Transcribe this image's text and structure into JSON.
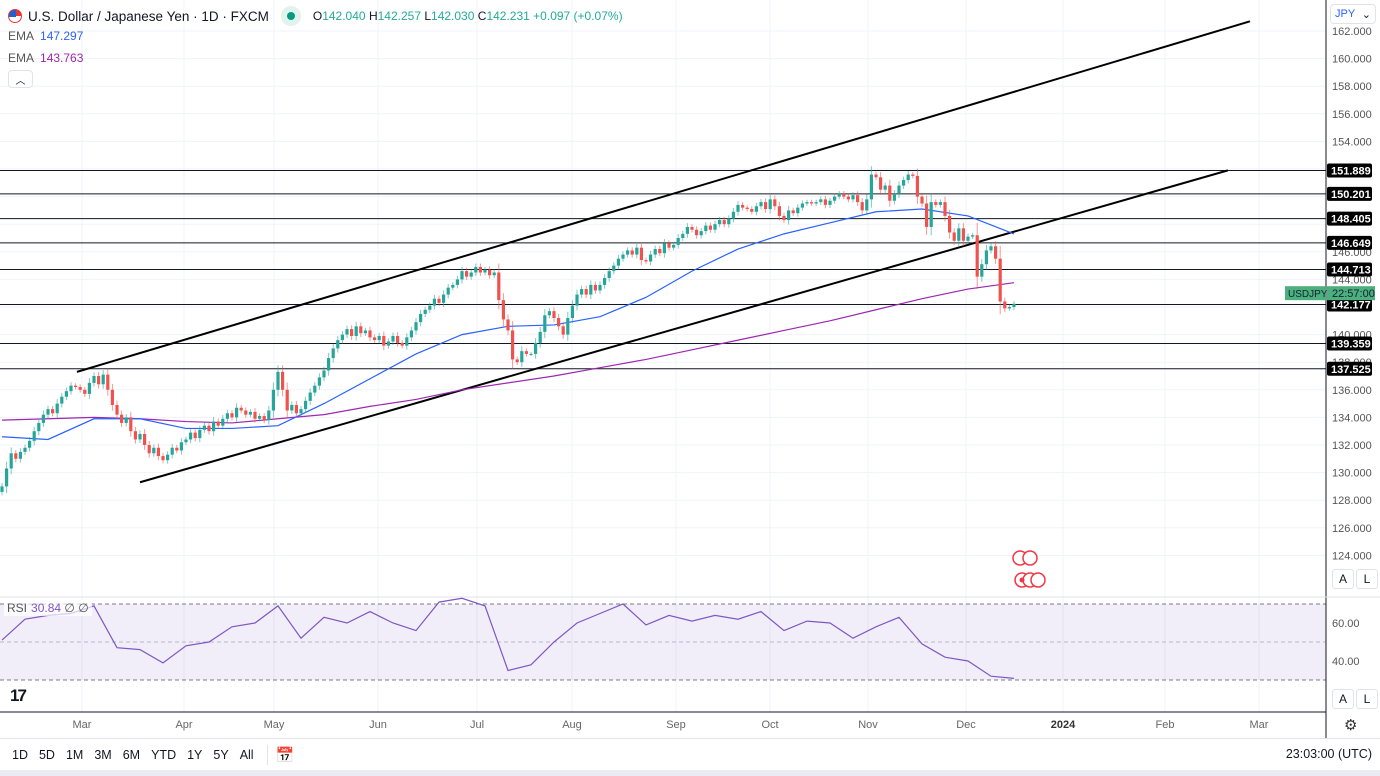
{
  "header": {
    "symbol_title": "U.S. Dollar / Japanese Yen · 1D · FXCM",
    "open_label": "O",
    "open": "142.040",
    "high_label": "H",
    "high": "142.257",
    "low_label": "L",
    "low": "142.030",
    "close_label": "C",
    "close": "142.231",
    "change": "+0.097 (+0.07%)",
    "collapse_icon": "chevron-up-icon"
  },
  "indicators": [
    {
      "name": "EMA",
      "value": "147.297",
      "color": "#2962ff"
    },
    {
      "name": "EMA",
      "value": "143.763",
      "color": "#9c27b0"
    }
  ],
  "rsi": {
    "name": "RSI",
    "value": "30.84",
    "extra1": "∅",
    "extra2": "∅",
    "color": "#7e57c2"
  },
  "currency_select": "JPY",
  "price_axis_ticks": [
    "162.000",
    "160.000",
    "158.000",
    "156.000",
    "154.000",
    "146.000",
    "144.000",
    "140.000",
    "138.000",
    "136.000",
    "134.000",
    "132.000",
    "130.000",
    "128.000",
    "126.000",
    "124.000"
  ],
  "rsi_axis_ticks": [
    "60.00",
    "40.00"
  ],
  "time_axis_ticks": [
    "Mar",
    "Apr",
    "May",
    "Jun",
    "Jul",
    "Aug",
    "Sep",
    "Oct",
    "Nov",
    "Dec",
    "2024",
    "Feb",
    "Mar"
  ],
  "level_labels": [
    "151.889",
    "150.201",
    "148.405",
    "146.649",
    "144.713",
    "142.177",
    "139.359",
    "137.525"
  ],
  "price_tag": {
    "symbol": "USDJPY",
    "countdown": "22:57:00"
  },
  "scale_buttons": {
    "auto": "A",
    "log": "L"
  },
  "toolbar": {
    "timeframes": [
      "1D",
      "5D",
      "1M",
      "3M",
      "6M",
      "YTD",
      "1Y",
      "5Y",
      "All"
    ],
    "date_range_icon": "calendar-goto-icon",
    "clock": "23:03:00 (UTC)"
  },
  "colors": {
    "up": "#26a69a",
    "down": "#ef5350",
    "ema_fast": "#2962ff",
    "ema_slow": "#9c27b0",
    "rsi": "#7e57c2",
    "price_tag": "#4caf7d"
  },
  "chart_data": {
    "type": "candlestick",
    "ylim": [
      122.5,
      163
    ],
    "rsi_ylim": [
      20,
      80
    ],
    "grid": true,
    "closes": [
      129.0,
      130.3,
      131.4,
      131.0,
      131.5,
      131.8,
      132.3,
      133.0,
      133.6,
      134.2,
      134.6,
      134.3,
      135.0,
      135.5,
      135.9,
      136.3,
      136.2,
      136.0,
      135.7,
      136.5,
      137.0,
      136.4,
      137.1,
      136.0,
      134.9,
      134.2,
      133.6,
      134.0,
      133.0,
      132.4,
      132.8,
      132.0,
      131.4,
      131.8,
      131.2,
      130.9,
      131.3,
      131.8,
      131.6,
      132.2,
      132.4,
      132.9,
      132.5,
      133.1,
      133.4,
      133.0,
      133.7,
      133.4,
      133.9,
      134.3,
      134.0,
      134.7,
      134.5,
      134.2,
      134.4,
      133.9,
      134.1,
      133.8,
      134.5,
      136.0,
      137.3,
      136.0,
      134.5,
      134.9,
      134.3,
      134.6,
      135.2,
      135.8,
      136.3,
      136.9,
      137.4,
      138.3,
      139.0,
      139.6,
      140.0,
      140.4,
      139.9,
      140.6,
      140.1,
      140.3,
      139.8,
      139.6,
      139.9,
      139.2,
      139.5,
      139.9,
      139.4,
      139.2,
      139.8,
      140.3,
      140.9,
      141.5,
      141.8,
      142.1,
      142.6,
      142.3,
      142.9,
      143.4,
      143.6,
      144.0,
      144.6,
      144.2,
      144.5,
      144.9,
      144.5,
      144.7,
      144.3,
      144.5,
      142.5,
      141.1,
      140.3,
      138.2,
      138.0,
      138.8,
      138.6,
      138.6,
      139.4,
      140.2,
      141.4,
      141.7,
      141.2,
      140.6,
      140.0,
      141.2,
      142.1,
      142.9,
      143.3,
      142.9,
      143.6,
      143.2,
      143.6,
      144.1,
      144.6,
      145.0,
      145.5,
      145.8,
      146.1,
      145.8,
      146.3,
      145.4,
      145.3,
      145.8,
      146.2,
      145.9,
      146.6,
      146.3,
      146.5,
      147.0,
      147.3,
      147.8,
      147.6,
      147.2,
      147.5,
      147.9,
      147.6,
      148.0,
      148.3,
      148.0,
      148.4,
      148.9,
      149.4,
      149.2,
      149.1,
      148.9,
      149.3,
      149.6,
      149.1,
      149.8,
      149.3,
      148.6,
      148.3,
      149.0,
      148.8,
      149.2,
      149.5,
      149.6,
      149.5,
      149.6,
      149.8,
      149.4,
      149.7,
      150.0,
      150.2,
      150.0,
      149.8,
      150.1,
      149.6,
      149.0,
      149.8,
      151.6,
      151.4,
      150.5,
      150.8,
      149.7,
      150.2,
      150.8,
      151.2,
      151.6,
      151.5,
      150.0,
      149.5,
      147.8,
      149.6,
      149.4,
      149.6,
      148.6,
      147.4,
      146.8,
      147.7,
      146.8,
      147.1,
      147.2,
      144.2,
      145.1,
      146.1,
      146.4,
      145.5,
      142.4,
      141.9,
      142.0,
      142.231
    ],
    "ema_fast_every_10": [
      132.6,
      132.4,
      133.9,
      133.9,
      133.2,
      133.2,
      133.4,
      135.0,
      136.8,
      138.6,
      140.0,
      140.6,
      140.7,
      141.3,
      142.7,
      144.6,
      146.2,
      147.3,
      148.1,
      148.9,
      149.1,
      148.6,
      147.297
    ],
    "ema_slow_every_10": [
      133.8,
      133.9,
      134.0,
      133.9,
      133.7,
      133.6,
      133.9,
      134.2,
      134.8,
      135.3,
      136.0,
      136.5,
      137.0,
      137.6,
      138.2,
      138.9,
      139.6,
      140.3,
      141.0,
      141.8,
      142.6,
      143.3,
      143.763
    ],
    "rsi_every_5": [
      51,
      62,
      64,
      65,
      69,
      47,
      46,
      39,
      48,
      50,
      58,
      60,
      69,
      52,
      63,
      60,
      66,
      60,
      56,
      71,
      73,
      69,
      35,
      38,
      50,
      60,
      65,
      70,
      59,
      64,
      61,
      64,
      62,
      66,
      56,
      61,
      60,
      52,
      58,
      63,
      49,
      42,
      40,
      32,
      30.84
    ],
    "rsi_bands": [
      70,
      50,
      30
    ],
    "horizontal_levels": [
      151.889,
      150.201,
      148.405,
      146.649,
      144.713,
      142.177,
      139.359,
      137.525
    ],
    "trendlines": [
      {
        "from": {
          "bar": 16.3,
          "price": 137.3
        },
        "to": {
          "bar": 271.3,
          "price": 162.7
        }
      },
      {
        "from": {
          "bar": 30,
          "price": 129.3
        },
        "to": {
          "bar": 266.5,
          "price": 151.9
        }
      }
    ]
  }
}
